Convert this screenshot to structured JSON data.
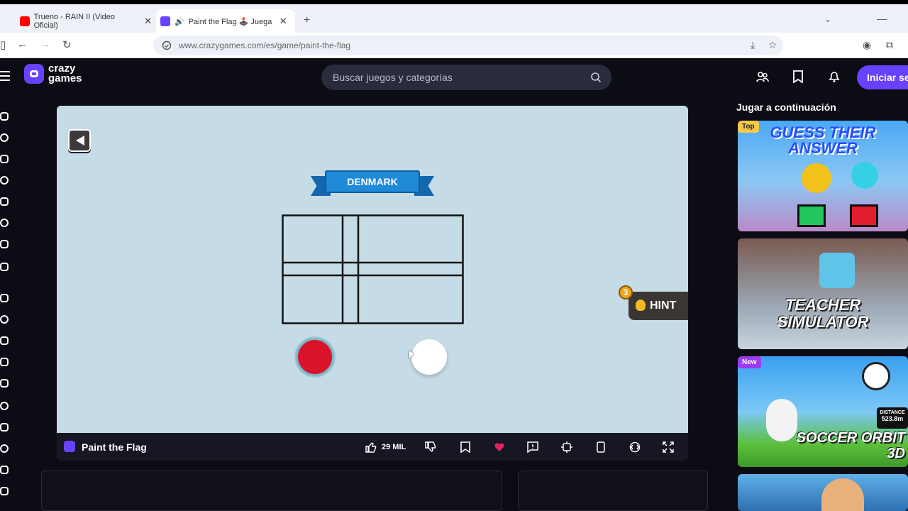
{
  "browser": {
    "tabs": [
      {
        "label": "Trueno - RAIN II (Video Oficial)",
        "favicon_color": "#ff0000"
      },
      {
        "label": "Paint the Flag 🕹️ Juega en",
        "favicon_color": "#6842ff"
      }
    ],
    "new_tab": "+",
    "url": "www.crazygames.com/es/game/paint-the-flag"
  },
  "site": {
    "logo_line1": "crazy",
    "logo_line2": "games",
    "search_placeholder": "Buscar juegos y categorías",
    "login_label": "Iniciar se"
  },
  "game": {
    "country": "DENMARK",
    "hint_label": "HINT",
    "hint_count": "3",
    "swatches": [
      {
        "color": "#d9132a"
      },
      {
        "color": "#ffffff"
      }
    ],
    "title": "Paint the Flag",
    "likes": "29 MIL"
  },
  "sidebar": {
    "title": "Jugar a continuación",
    "cards": [
      {
        "badge": "Top",
        "title": "GUESS THEIR ANSWER"
      },
      {
        "badge": "",
        "title": "TEACHER SIMULATOR"
      },
      {
        "badge": "New",
        "title": "SOCCER ORBIT 3D",
        "distance_label": "DISTANCE",
        "distance_value": "523.8m"
      }
    ]
  },
  "colors": {
    "accent": "#6842ff",
    "game_bg": "#c5dce6",
    "ribbon": "#1f8ad8"
  }
}
